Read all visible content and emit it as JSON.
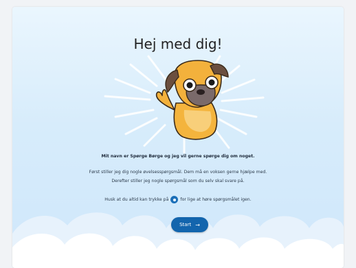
{
  "welcome": {
    "title": "Hej med dig!",
    "intro": "Mit navn er Spørge Børge og jeg vil gerne spørge dig om noget.",
    "line1": "Først stiller jeg dig nogle øvelsesspørgsmål. Dem må en voksen gerne hjælpe med.",
    "line2": "Derefter stiller jeg nogle spørgsmål som du selv skal svare på.",
    "hint_before": "Husk at du altid kan trykke på",
    "hint_after": "for lige at høre spørgsmålet igen.",
    "start_label": "Start"
  },
  "icons": {
    "mascot": "pug-waving",
    "info": "audio-info-icon",
    "arrow": "arrow-right-icon"
  },
  "colors": {
    "accent": "#1365ad",
    "background_top": "#eaf6fe",
    "background_bottom": "#cfe7fb"
  }
}
